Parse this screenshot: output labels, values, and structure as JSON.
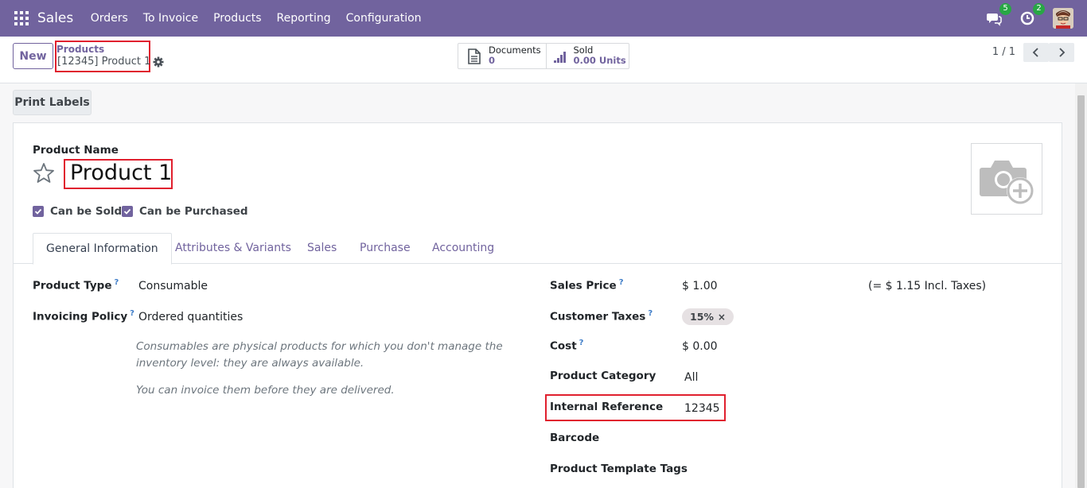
{
  "navbar": {
    "app_name": "Sales",
    "menu": [
      "Orders",
      "To Invoice",
      "Products",
      "Reporting",
      "Configuration"
    ],
    "messages_badge": "5",
    "activities_badge": "2",
    "brand_color": "#71639e"
  },
  "control_panel": {
    "new_label": "New",
    "breadcrumb_parent": "Products",
    "breadcrumb_current": "[12345] Product 1",
    "smart_buttons": {
      "documents_label": "Documents",
      "documents_value": "0",
      "sold_label": "Sold",
      "sold_value": "0.00 Units"
    },
    "pager": "1 / 1"
  },
  "actions": {
    "print_labels": "Print Labels"
  },
  "form": {
    "product_name_label": "Product Name",
    "product_name": "Product 1",
    "can_be_sold_label": "Can be Sold",
    "can_be_sold": true,
    "can_be_purchased_label": "Can be Purchased",
    "can_be_purchased": true,
    "tabs": [
      "General Information",
      "Attributes & Variants",
      "Sales",
      "Purchase",
      "Accounting"
    ],
    "active_tab": "General Information",
    "left": {
      "product_type_label": "Product Type",
      "product_type": "Consumable",
      "invoicing_policy_label": "Invoicing Policy",
      "invoicing_policy": "Ordered quantities",
      "help_consumable": "Consumables are physical products for which you don't manage the inventory level: they are always available.",
      "help_invoice": "You can invoice them before they are delivered."
    },
    "right": {
      "sales_price_label": "Sales Price",
      "sales_price": "$ 1.00",
      "incl_taxes": "(= $ 1.15 Incl. Taxes)",
      "customer_taxes_label": "Customer Taxes",
      "customer_tax_tag": "15%",
      "cost_label": "Cost",
      "cost": "$ 0.00",
      "product_category_label": "Product Category",
      "product_category": "All",
      "internal_reference_label": "Internal Reference",
      "internal_reference": "12345",
      "barcode_label": "Barcode",
      "barcode": "",
      "template_tags_label": "Product Template Tags"
    },
    "help_marker": "?"
  }
}
